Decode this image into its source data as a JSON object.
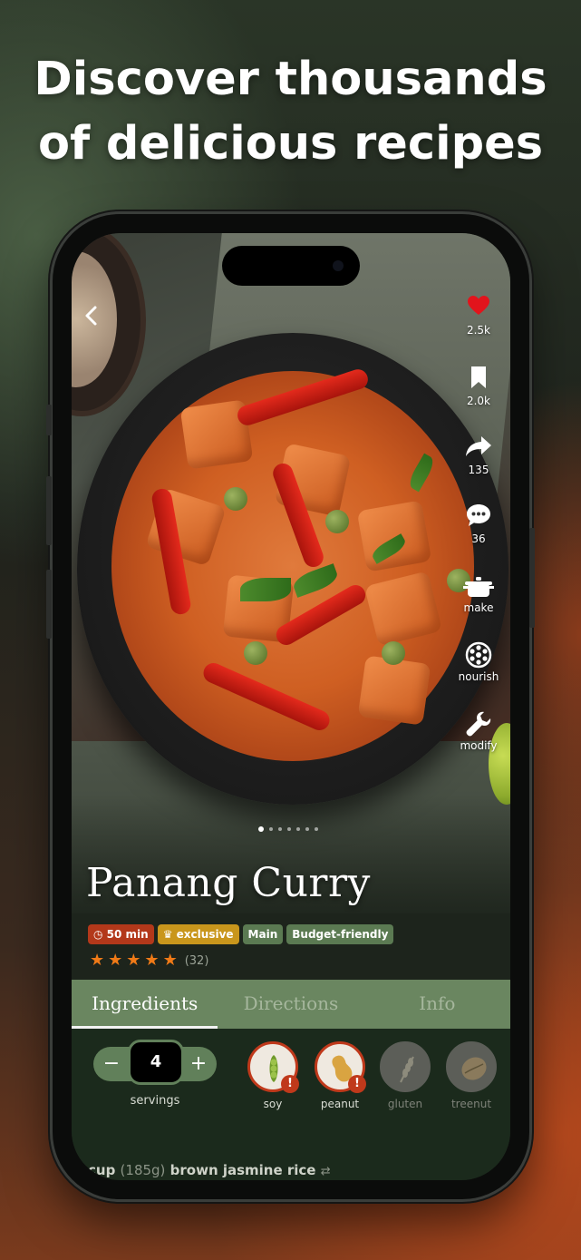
{
  "headline": {
    "line1": "Discover thousands",
    "line2": "of delicious recipes"
  },
  "recipe": {
    "title": "Panang Curry",
    "tags": {
      "time": "50 min",
      "exclusive": "exclusive",
      "course": "Main",
      "budget": "Budget-friendly"
    },
    "rating": {
      "stars": 5,
      "count": "(32)"
    }
  },
  "actions": {
    "likes": "2.5k",
    "saves": "2.0k",
    "shares": "135",
    "comments": "36",
    "make": "make",
    "nourish": "nourish",
    "modify": "modify"
  },
  "carousel": {
    "total": 7,
    "active": 0
  },
  "tabs": [
    "Ingredients",
    "Directions",
    "Info"
  ],
  "servings": {
    "value": "4",
    "label": "servings",
    "minus": "−",
    "plus": "+"
  },
  "allergens": [
    {
      "label": "soy",
      "active": true
    },
    {
      "label": "peanut",
      "active": true
    },
    {
      "label": "gluten",
      "active": false
    },
    {
      "label": "treenut",
      "active": false
    }
  ],
  "ingredient": {
    "qty": "cup",
    "amount": "(185g)",
    "name": "brown jasmine rice"
  },
  "colors": {
    "accent_green": "#6a8660",
    "alert_red": "#c0391b",
    "star_orange": "#f07a17",
    "exclusive_gold": "#c9961c"
  }
}
